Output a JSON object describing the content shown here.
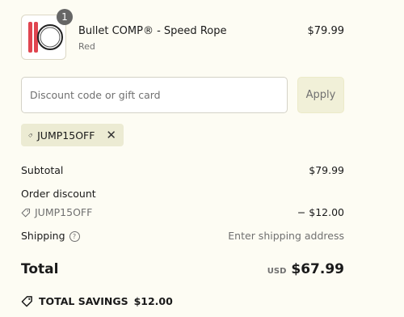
{
  "product": {
    "quantity": "1",
    "name": "Bullet COMP® - Speed Rope",
    "variant": "Red",
    "price": "$79.99"
  },
  "discount": {
    "placeholder": "Discount code or gift card",
    "apply_label": "Apply",
    "applied_code": "JUMP15OFF"
  },
  "summary": {
    "subtotal_label": "Subtotal",
    "subtotal_value": "$79.99",
    "order_discount_label": "Order discount",
    "order_discount_code": "JUMP15OFF",
    "order_discount_value": "− $12.00",
    "shipping_label": "Shipping",
    "shipping_value": "Enter shipping address",
    "total_label": "Total",
    "total_currency": "USD",
    "total_value": "$67.99",
    "savings_label": "TOTAL SAVINGS",
    "savings_value": "$12.00"
  },
  "colors": {
    "background": "#fdfcf3",
    "chip": "#ecebd3",
    "apply_button": "#f1f0d8",
    "rope_handle": "#e0454f"
  }
}
